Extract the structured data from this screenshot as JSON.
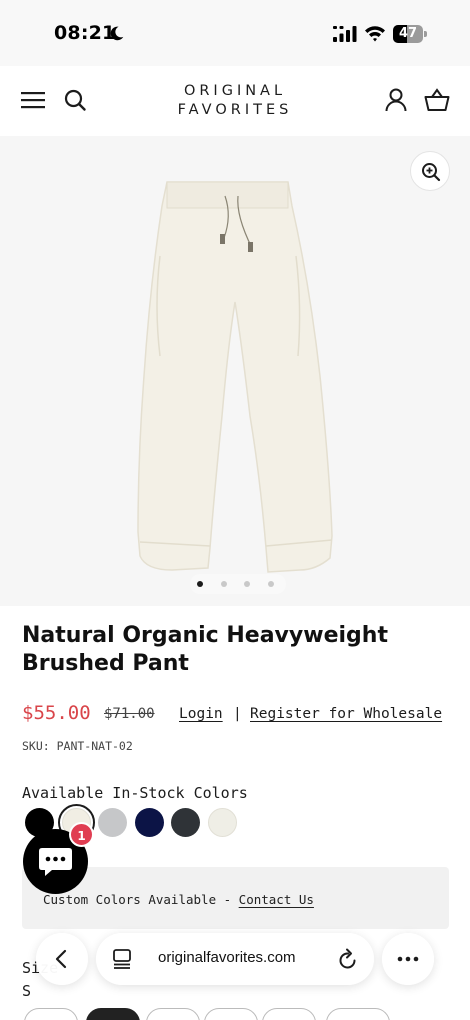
{
  "status_bar": {
    "time": "08:21",
    "battery_level": "47",
    "icons": [
      "moon-icon",
      "signal-icon",
      "wifi-icon",
      "battery-icon"
    ]
  },
  "header": {
    "brand_line1": "ORIGINAL",
    "brand_line2": "FAVORITES",
    "icons": [
      "menu-icon",
      "search-icon",
      "account-icon",
      "basket-icon"
    ]
  },
  "gallery": {
    "image_count": 4,
    "active_index": 0,
    "zoom_icon": "zoom-in-icon",
    "product_color": "#f3f0e6"
  },
  "product": {
    "title": "Natural Organic Heavyweight Brushed Pant",
    "price": "$55.00",
    "compare_price": "$71.00",
    "login_label": "Login",
    "separator": "|",
    "wholesale_label": "Register for Wholesale",
    "sku": "SKU: PANT-NAT-02",
    "price_color": "#d9454a"
  },
  "colors": {
    "label": "Available In-Stock Colors",
    "swatches": [
      {
        "hex": "#000000"
      },
      {
        "hex": "#f1eee4",
        "selected": true
      },
      {
        "hex": "#c6c7c9"
      },
      {
        "hex": "#0c1446"
      },
      {
        "hex": "#2f3337"
      },
      {
        "hex": "#efeee6"
      }
    ]
  },
  "custom": {
    "text": "Custom Colors Available - ",
    "link": "Contact Us"
  },
  "size": {
    "label": "Size",
    "value": "S"
  },
  "chat": {
    "badge": "1",
    "icon": "chat-icon"
  },
  "browser": {
    "url": "originalfavorites.com",
    "icons": [
      "back-icon",
      "tabs-icon",
      "reload-icon",
      "more-icon"
    ]
  }
}
